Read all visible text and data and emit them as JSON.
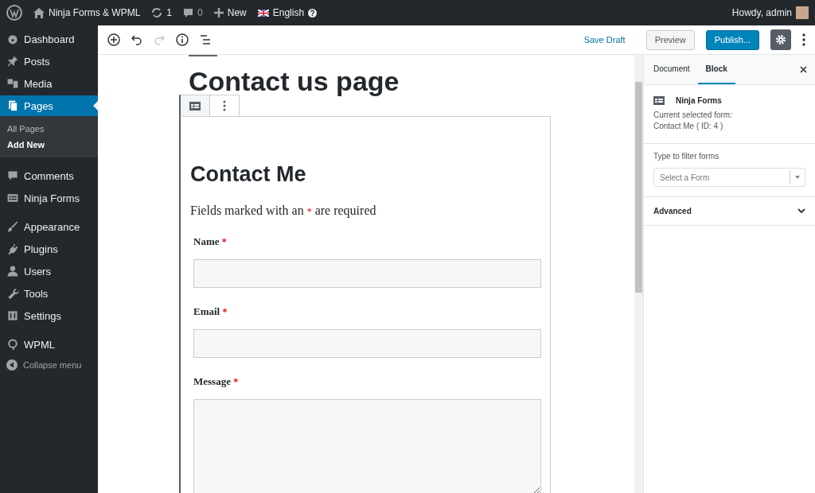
{
  "admin_bar": {
    "site": "Ninja Forms & WPML",
    "updates": "1",
    "comments": "0",
    "new": "New",
    "language": "English",
    "greeting": "Howdy, admin"
  },
  "sidebar": {
    "items": [
      {
        "label": "Dashboard",
        "selected": false
      },
      {
        "label": "Posts",
        "selected": false
      },
      {
        "label": "Media",
        "selected": false
      },
      {
        "label": "Pages",
        "selected": true,
        "children": [
          {
            "label": "All Pages",
            "selected": false
          },
          {
            "label": "Add New",
            "selected": true
          }
        ]
      },
      {
        "label": "Comments",
        "selected": false
      },
      {
        "label": "Ninja Forms",
        "selected": false
      },
      {
        "label": "Appearance",
        "selected": false
      },
      {
        "label": "Plugins",
        "selected": false
      },
      {
        "label": "Users",
        "selected": false
      },
      {
        "label": "Tools",
        "selected": false
      },
      {
        "label": "Settings",
        "selected": false
      },
      {
        "label": "WPML",
        "selected": false
      }
    ],
    "collapse": "Collapse menu"
  },
  "toolbar": {
    "redo_disabled": true,
    "save_draft": "Save Draft",
    "preview": "Preview",
    "publish": "Publish..."
  },
  "editor": {
    "title": "Contact us page",
    "form": {
      "heading": "Contact Me",
      "note_before": "Fields marked with an",
      "note_mark": "*",
      "note_after": "are required",
      "fields": [
        {
          "label": "Name",
          "required_mark": "*",
          "kind": "text"
        },
        {
          "label": "Email",
          "required_mark": "*",
          "kind": "text"
        },
        {
          "label": "Message",
          "required_mark": "*",
          "kind": "textarea"
        }
      ]
    }
  },
  "settings_panel": {
    "tabs": [
      {
        "label": "Document",
        "selected": false
      },
      {
        "label": "Block",
        "selected": true
      }
    ],
    "block_name": "Ninja Forms",
    "current_label": "Current selected form:",
    "current_value": "Contact Me ( ID: 4 )",
    "filter_label": "Type to filter forms",
    "select": {
      "placeholder": "Select a Form"
    },
    "advanced": {
      "label": "Advanced",
      "expanded": false
    }
  }
}
